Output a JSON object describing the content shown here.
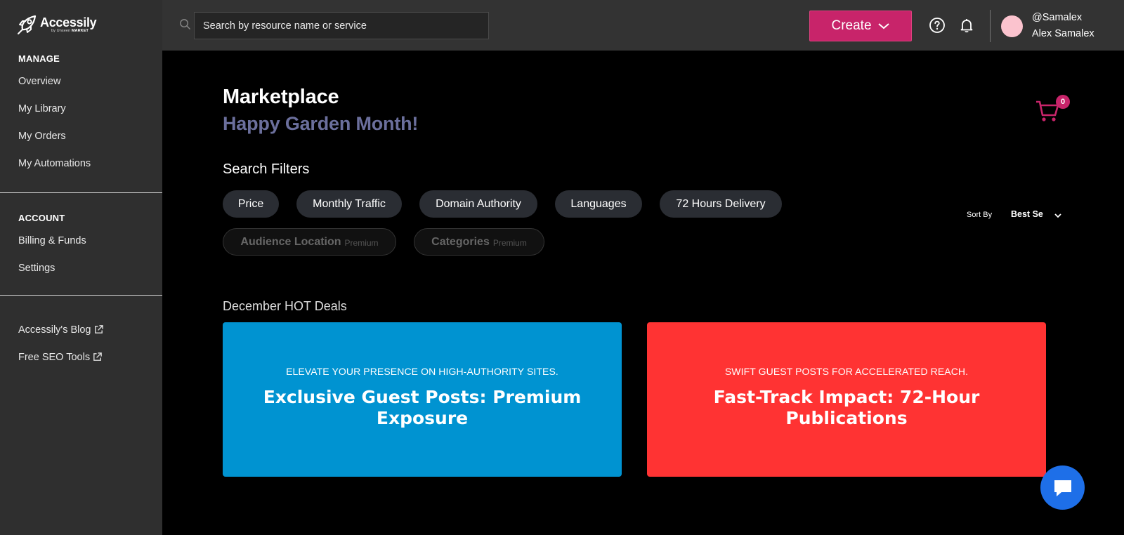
{
  "brand": {
    "name": "Accessily",
    "sub_prefix": "by Unseen",
    "sub_bold": "MARKET"
  },
  "sidebar": {
    "manage_heading": "MANAGE",
    "manage_items": [
      {
        "label": "Overview"
      },
      {
        "label": "My Library"
      },
      {
        "label": "My Orders"
      },
      {
        "label": "My Automations"
      }
    ],
    "account_heading": "ACCOUNT",
    "account_items": [
      {
        "label": "Billing & Funds"
      },
      {
        "label": "Settings"
      }
    ],
    "external_items": [
      {
        "label": "Accessily's Blog",
        "icon": "external-link-icon"
      },
      {
        "label": "Free SEO Tools",
        "icon": "external-link-icon"
      }
    ]
  },
  "topbar": {
    "search_placeholder": "Search by resource name or service",
    "create_label": "Create",
    "user_handle": "@Samalex",
    "user_name": "Alex Samalex",
    "colors": {
      "create_button": "#c8246a",
      "avatar": "#fbc3ce"
    }
  },
  "main": {
    "title": "Marketplace",
    "subtitle": "Happy Garden Month!",
    "cart_count": "0",
    "filters_heading": "Search Filters",
    "filters": [
      {
        "label": "Price"
      },
      {
        "label": "Monthly Traffic"
      },
      {
        "label": "Domain Authority"
      },
      {
        "label": "Languages"
      },
      {
        "label": "72 Hours Delivery"
      }
    ],
    "premium_filters": [
      {
        "label": "Audience Location",
        "tag": "Premium"
      },
      {
        "label": "Categories",
        "tag": "Premium"
      }
    ],
    "sort": {
      "label": "Sort By",
      "value": "Best Se"
    },
    "deals_heading": "December HOT Deals",
    "deals": [
      {
        "tag": "ELEVATE YOUR PRESENCE ON HIGH-AUTHORITY SITES.",
        "title": "Exclusive Guest Posts: Premium Exposure",
        "color": "#0093d1"
      },
      {
        "tag": "SWIFT GUEST POSTS FOR ACCELERATED REACH.",
        "title": "Fast-Track Impact: 72-Hour Publications",
        "color": "#ff3333"
      }
    ]
  }
}
